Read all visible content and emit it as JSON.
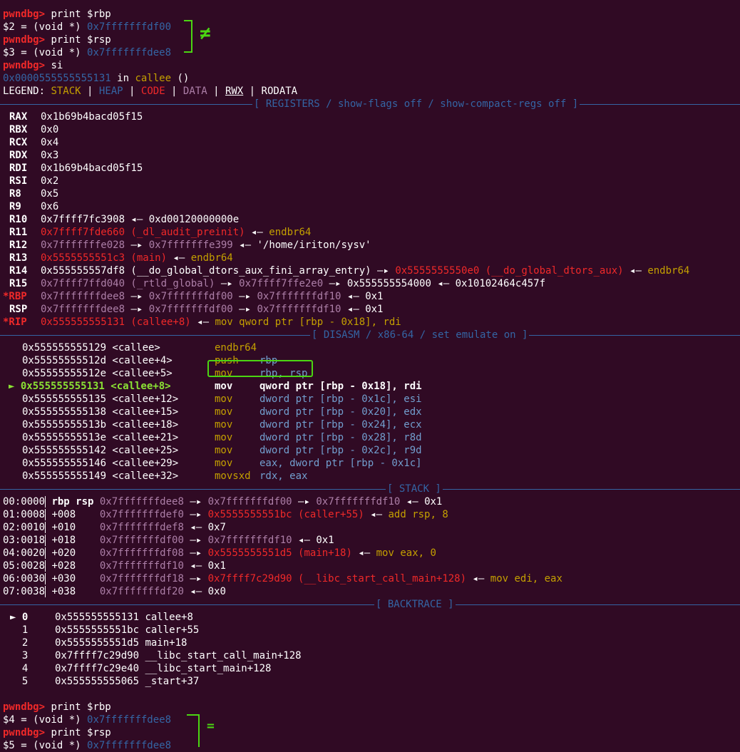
{
  "top_partial": "    ...                  ",
  "print1": {
    "prompt": "pwndbg>",
    "cmd": " print $rbp",
    "result": "$2 = (void *) ",
    "value": "0x7fffffffdf00"
  },
  "print2": {
    "prompt": "pwndbg>",
    "cmd": " print $rsp",
    "result": "$3 = (void *) ",
    "value": "0x7fffffffdee8"
  },
  "annotation1": "≠",
  "si": {
    "prompt": "pwndbg>",
    "cmd": " si"
  },
  "location": {
    "addr": "0x0000555555555131",
    "in": " in ",
    "func": "callee",
    "args": " ()"
  },
  "legend": {
    "label": "LEGEND: ",
    "stack": "STACK",
    "heap": "HEAP",
    "code": "CODE",
    "data": "DATA",
    "rwx": "RWX",
    "rodata": "RODATA",
    "sep": " | "
  },
  "headers": {
    "registers": "[ REGISTERS / show-flags off / show-compact-regs off ]",
    "disasm": "[ DISASM / x86-64 / set emulate on ]",
    "stack": "[ STACK ]",
    "backtrace": "[ BACKTRACE ]"
  },
  "registers": [
    {
      "mark": " ",
      "name": "RAX",
      "value": "0x1b69b4bacd05f15"
    },
    {
      "mark": " ",
      "name": "RBX",
      "value": "0x0"
    },
    {
      "mark": " ",
      "name": "RCX",
      "value": "0x4"
    },
    {
      "mark": " ",
      "name": "RDX",
      "value": "0x3"
    },
    {
      "mark": " ",
      "name": "RDI",
      "value": "0x1b69b4bacd05f15"
    },
    {
      "mark": " ",
      "name": "RSI",
      "value": "0x2"
    },
    {
      "mark": " ",
      "name": "R8",
      "value": "0x5"
    },
    {
      "mark": " ",
      "name": "R9",
      "value": "0x6"
    },
    {
      "mark": " ",
      "name": "R10",
      "value": "0x7ffff7fc3908 ◂— 0xd00120000000e"
    },
    {
      "mark": " ",
      "name": "R11",
      "code": "0x7ffff7fde660 (_dl_audit_preinit)",
      "rest": " ◂— ",
      "ins": "endbr64"
    },
    {
      "mark": " ",
      "name": "R12",
      "stack": "0x7fffffffe028",
      "arrow": " —▸ ",
      "stack2": "0x7fffffffe399",
      "rest": " ◂— '/home/iriton/sysv'"
    },
    {
      "mark": " ",
      "name": "R13",
      "code": "0x5555555551c3 (main)",
      "rest": " ◂— ",
      "ins": "endbr64"
    },
    {
      "mark": " ",
      "name": "R14",
      "plain": "0x555555557df8 (__do_global_dtors_aux_fini_array_entry)",
      "arrow": " —▸ ",
      "code": "0x5555555550e0 (__do_global_dtors_aux)",
      "rest": " ◂— ",
      "ins": "endbr64"
    },
    {
      "mark": " ",
      "name": "R15",
      "data": "0x7ffff7ffd040 (_rtld_global)",
      "arrow": " —▸ ",
      "data2": "0x7ffff7ffe2e0",
      "rest": " —▸ 0x555555554000 ◂— 0x10102464c457f"
    },
    {
      "mark": "*",
      "name": "RBP",
      "stack": "0x7fffffffdee8",
      "arrow": " —▸ ",
      "stack2": "0x7fffffffdf00",
      "arrow2": " —▸ ",
      "stack3": "0x7fffffffdf10",
      "rest": " ◂— 0x1"
    },
    {
      "mark": " ",
      "name": "RSP",
      "stack": "0x7fffffffdee8",
      "arrow": " —▸ ",
      "stack2": "0x7fffffffdf00",
      "arrow2": " —▸ ",
      "stack3": "0x7fffffffdf10",
      "rest": " ◂— 0x1"
    },
    {
      "mark": "*",
      "name": "RIP",
      "code": "0x555555555131 (callee+8)",
      "rest": " ◂— ",
      "ins": "mov qword ptr [rbp - 0x18], rdi"
    }
  ],
  "disasm": [
    {
      "addr": "0x555555555129 <callee>",
      "mn": "endbr64",
      "ops": ""
    },
    {
      "addr": "0x55555555512d <callee+4>",
      "mn": "push",
      "ops": "rbp"
    },
    {
      "addr": "0x55555555512e <callee+5>",
      "mn": "mov",
      "ops": "rbp, rsp"
    },
    {
      "addr": "0x555555555131 <callee+8>",
      "mn": "mov",
      "ops": "qword ptr [rbp - 0x18], rdi",
      "current": true,
      "marker": "►"
    },
    {
      "addr": "0x555555555135 <callee+12>",
      "mn": "mov",
      "ops": "dword ptr [rbp - 0x1c], esi"
    },
    {
      "addr": "0x555555555138 <callee+15>",
      "mn": "mov",
      "ops": "dword ptr [rbp - 0x20], edx"
    },
    {
      "addr": "0x55555555513b <callee+18>",
      "mn": "mov",
      "ops": "dword ptr [rbp - 0x24], ecx"
    },
    {
      "addr": "0x55555555513e <callee+21>",
      "mn": "mov",
      "ops": "dword ptr [rbp - 0x28], r8d"
    },
    {
      "addr": "0x555555555142 <callee+25>",
      "mn": "mov",
      "ops": "dword ptr [rbp - 0x2c], r9d"
    },
    {
      "addr": "0x555555555146 <callee+29>",
      "mn": "mov",
      "ops": "eax, dword ptr [rbp - 0x1c]"
    },
    {
      "addr": "0x555555555149 <callee+32>",
      "mn": "movsxd",
      "ops": "rdx, eax"
    }
  ],
  "stack": [
    {
      "idx": "00:0000",
      "off": " rbp rsp ",
      "addr": "0x7fffffffdee8",
      "a1": " —▸ ",
      "v1": "0x7fffffffdf00",
      "a2": " —▸ ",
      "v2": "0x7fffffffdf10",
      "rest": " ◂— 0x1"
    },
    {
      "idx": "01:0008",
      "off": " +008    ",
      "addr": "0x7fffffffdef0",
      "a1": " —▸ ",
      "code": "0x5555555551bc (caller+55)",
      "rest": " ◂— ",
      "ins": "add rsp, 8"
    },
    {
      "idx": "02:0010",
      "off": " +010    ",
      "addr": "0x7fffffffdef8",
      "rest": " ◂— 0x7"
    },
    {
      "idx": "03:0018",
      "off": " +018    ",
      "addr": "0x7fffffffdf00",
      "a1": " —▸ ",
      "v1": "0x7fffffffdf10",
      "rest": " ◂— 0x1"
    },
    {
      "idx": "04:0020",
      "off": " +020    ",
      "addr": "0x7fffffffdf08",
      "a1": " —▸ ",
      "code": "0x5555555551d5 (main+18)",
      "rest": " ◂— ",
      "ins": "mov eax, 0"
    },
    {
      "idx": "05:0028",
      "off": " +028    ",
      "addr": "0x7fffffffdf10",
      "rest": " ◂— 0x1"
    },
    {
      "idx": "06:0030",
      "off": " +030    ",
      "addr": "0x7fffffffdf18",
      "a1": " —▸ ",
      "code": "0x7ffff7c29d90 (__libc_start_call_main+128)",
      "rest": " ◂— ",
      "ins": "mov edi, eax"
    },
    {
      "idx": "07:0038",
      "off": " +038    ",
      "addr": "0x7fffffffdf20",
      "rest": " ◂— 0x0"
    }
  ],
  "backtrace": [
    {
      "marker": "►",
      "idx": "0",
      "addr": "0x555555555131",
      "sym": "callee+8"
    },
    {
      "marker": " ",
      "idx": "1",
      "addr": "0x5555555551bc",
      "sym": "caller+55"
    },
    {
      "marker": " ",
      "idx": "2",
      "addr": "0x5555555551d5",
      "sym": "main+18"
    },
    {
      "marker": " ",
      "idx": "3",
      "addr": "0x7ffff7c29d90",
      "sym": "__libc_start_call_main+128"
    },
    {
      "marker": " ",
      "idx": "4",
      "addr": "0x7ffff7c29e40",
      "sym": "__libc_start_main+128"
    },
    {
      "marker": " ",
      "idx": "5",
      "addr": "0x555555555065",
      "sym": "_start+37"
    }
  ],
  "print3": {
    "prompt": "pwndbg>",
    "cmd": " print $rbp",
    "result": "$4 = (void *) ",
    "value": "0x7fffffffdee8"
  },
  "print4": {
    "prompt": "pwndbg>",
    "cmd": " print $rsp",
    "result": "$5 = (void *) ",
    "value": "0x7fffffffdee8"
  },
  "annotation2": "="
}
